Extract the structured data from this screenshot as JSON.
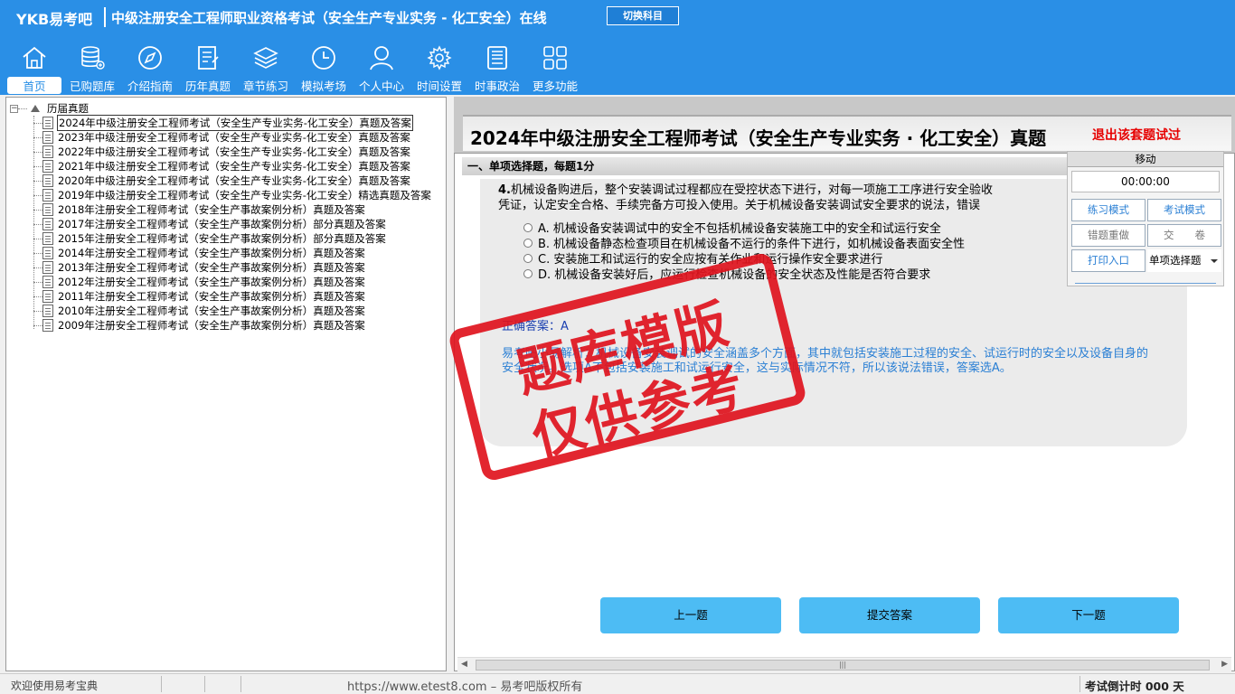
{
  "header": {
    "brand": "YKB易考吧",
    "title": "中级注册安全工程师职业资格考试（安全生产专业实务 - 化工安全）在线",
    "switch_label": "切换科目",
    "accent": "#2a8fe6"
  },
  "nav": [
    {
      "label": "首页",
      "icon": "home-icon"
    },
    {
      "label": "已购题库",
      "icon": "database-icon"
    },
    {
      "label": "介绍指南",
      "icon": "compass-icon"
    },
    {
      "label": "历年真题",
      "icon": "document-icon"
    },
    {
      "label": "章节练习",
      "icon": "layers-icon"
    },
    {
      "label": "模拟考场",
      "icon": "clock-icon"
    },
    {
      "label": "个人中心",
      "icon": "user-icon"
    },
    {
      "label": "时间设置",
      "icon": "gear-icon"
    },
    {
      "label": "时事政治",
      "icon": "news-icon"
    },
    {
      "label": "更多功能",
      "icon": "grid-icon"
    }
  ],
  "tree": {
    "root": "历届真题",
    "items": [
      "2024年中级注册安全工程师考试（安全生产专业实务-化工安全）真题及答案",
      "2023年中级注册安全工程师考试（安全生产专业实务-化工安全）真题及答案",
      "2022年中级注册安全工程师考试（安全生产专业实务-化工安全）真题及答案",
      "2021年中级注册安全工程师考试（安全生产专业实务-化工安全）真题及答案",
      "2020年中级注册安全工程师考试（安全生产专业实务-化工安全）真题及答案",
      "2019年中级注册安全工程师考试（安全生产专业实务-化工安全）精选真题及答案",
      "2018年注册安全工程师考试（安全生产事故案例分析）真题及答案",
      "2017年注册安全工程师考试（安全生产事故案例分析）部分真题及答案",
      "2015年注册安全工程师考试（安全生产事故案例分析）部分真题及答案",
      "2014年注册安全工程师考试（安全生产事故案例分析）真题及答案",
      "2013年注册安全工程师考试（安全生产事故案例分析）真题及答案",
      "2012年注册安全工程师考试（安全生产事故案例分析）真题及答案",
      "2011年注册安全工程师考试（安全生产事故案例分析）真题及答案",
      "2010年注册安全工程师考试（安全生产事故案例分析）真题及答案",
      "2009年注册安全工程师考试（安全生产事故案例分析）真题及答案"
    ]
  },
  "exam": {
    "title": "2024年中级注册安全工程师考试（安全生产专业实务 · 化工安全）真题",
    "exit_label": "退出该套题试过",
    "section": "一、单项选择题，每题1分",
    "question_num": "4.",
    "question_line1": "机械设备购进后，整个安装调试过程都应在受控状态下进行，对每一项施工工序进行安全验收",
    "question_line2": "凭证，认定安全合格、手续完备方可投入使用。关于机械设备安装调试安全要求的说法，错误",
    "options": [
      "A. 机械设备安装调试中的安全不包括机械设备安装施工中的安全和试运行安全",
      "B. 机械设备静态检查项目在机械设备不运行的条件下进行，如机械设备表面安全性",
      "C. 安装施工和试运行的安全应按有关作业和运行操作安全要求进行",
      "D. 机械设备安装好后，应运行检查机械设备的安全状态及性能是否符合要求"
    ],
    "answer": "正确答案：A",
    "analysis": "易考吧小易解析：机械设备安装调试的安全涵盖多个方面，其中就包括安装施工过程的安全、试运行时的安全以及设备自身的安全状况。选项A不包括安装施工和试运行安全，这与实际情况不符，所以该说法错误，答案选A。"
  },
  "control": {
    "move": "移动",
    "timer": "00:00:00",
    "practice_mode": "练习模式",
    "exam_mode": "考试模式",
    "wrong_redo": "错题重做",
    "submit_paper": "交　　卷",
    "print": "打印入口",
    "question_type": "单项选择题"
  },
  "buttons": {
    "prev": "上一题",
    "submit": "提交答案",
    "next": "下一题"
  },
  "stamp": {
    "line1": "题库模版",
    "line2": "仅供参考",
    "color": "#e0141e"
  },
  "status": {
    "welcome": "欢迎使用易考宝典",
    "copyright": "https://www.etest8.com – 易考吧版权所有",
    "countdown": "考试倒计时 000 天"
  }
}
